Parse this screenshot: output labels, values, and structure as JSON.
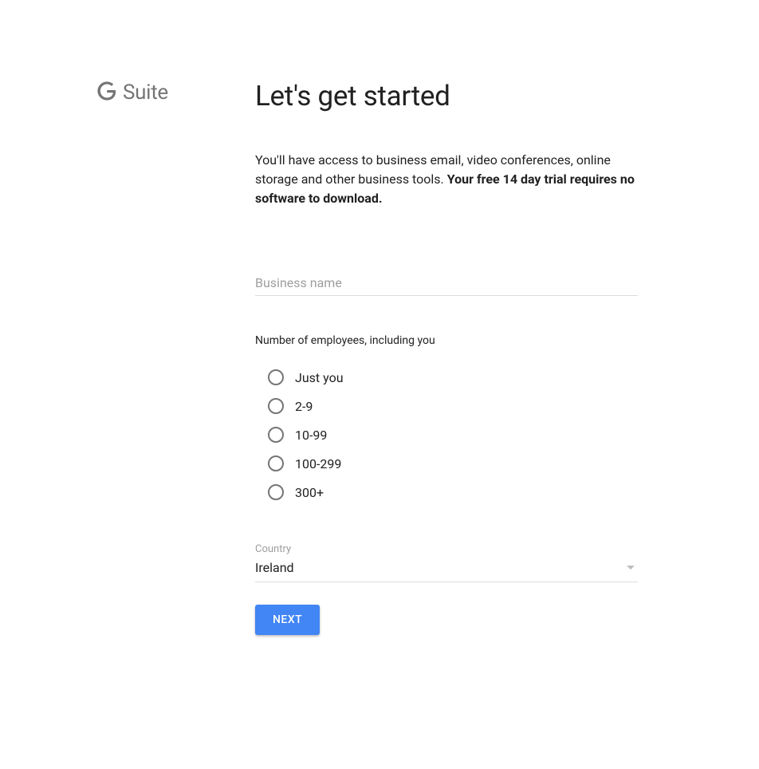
{
  "logo": {
    "suite_text": "Suite"
  },
  "title": "Let's get started",
  "intro": {
    "text": "You'll have access to business email, video conferences, online storage and other business tools. ",
    "bold": "Your free 14 day trial requires no software to download."
  },
  "business_name": {
    "placeholder": "Business name",
    "value": ""
  },
  "employees": {
    "label": "Number of employees, including you",
    "options": [
      "Just you",
      "2-9",
      "10-99",
      "100-299",
      "300+"
    ]
  },
  "country": {
    "label": "Country",
    "value": "Ireland"
  },
  "next_label": "NEXT"
}
